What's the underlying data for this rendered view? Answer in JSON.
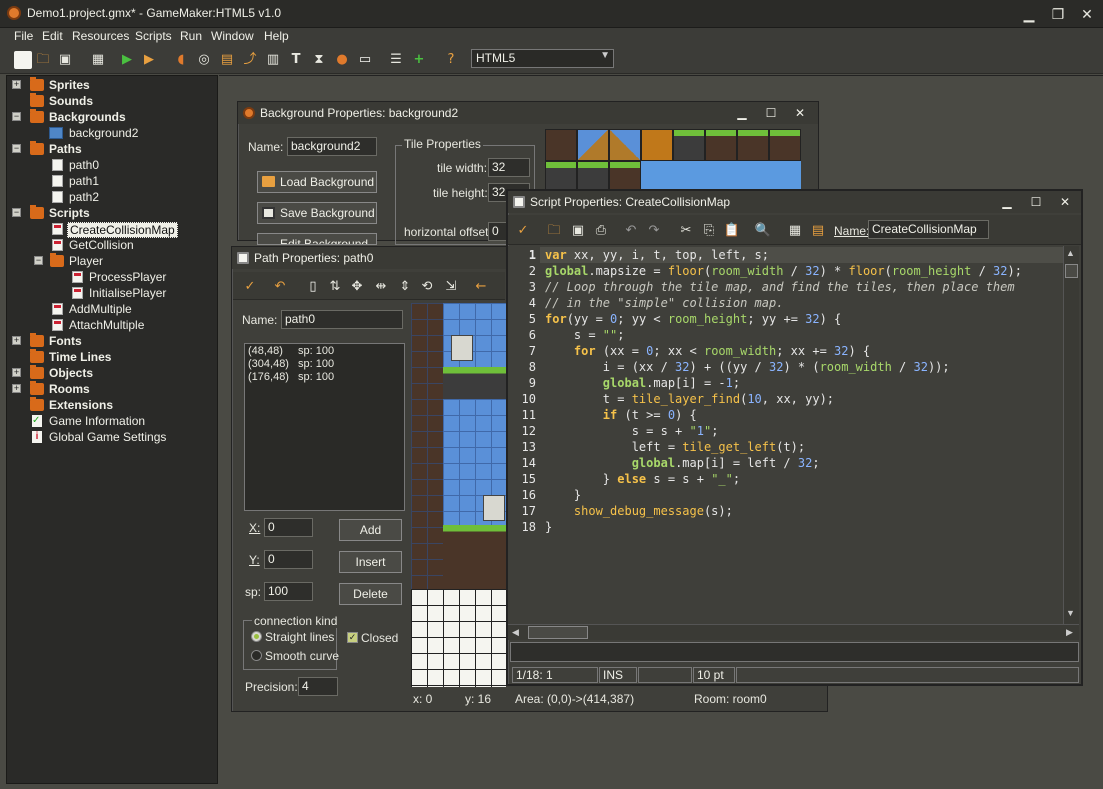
{
  "app": {
    "title": "Demo1.project.gmx* - GameMaker:HTML5 v1.0"
  },
  "menu": [
    "File",
    "Edit",
    "Resources",
    "Scripts",
    "Run",
    "Window",
    "Help"
  ],
  "toolbar": {
    "target": "HTML5"
  },
  "tree": {
    "sprites": "Sprites",
    "sounds": "Sounds",
    "backgrounds": "Backgrounds",
    "background2": "background2",
    "paths": "Paths",
    "path0": "path0",
    "path1": "path1",
    "path2": "path2",
    "scripts": "Scripts",
    "createcollisionmap": "CreateCollisionMap",
    "getcollision": "GetCollision",
    "player": "Player",
    "processplayer": "ProcessPlayer",
    "initialiseplayer": "InitialisePlayer",
    "addmultiple": "AddMultiple",
    "attachmultiple": "AttachMultiple",
    "fonts": "Fonts",
    "timelines": "Time Lines",
    "objects": "Objects",
    "rooms": "Rooms",
    "extensions": "Extensions",
    "gameinfo": "Game Information",
    "globalsettings": "Global Game Settings"
  },
  "bg_window": {
    "title": "Background Properties: background2",
    "name_label": "Name:",
    "name_value": "background2",
    "load": "Load Background",
    "save": "Save Background",
    "edit": "Edit Background",
    "tile_props": "Tile Properties",
    "tile_width_label": "tile width:",
    "tile_width": "32",
    "tile_height_label": "tile height:",
    "tile_height": "32",
    "hoffset_label": "horizontal offset:",
    "hoffset": "0"
  },
  "path_window": {
    "title": "Path Properties: path0",
    "name_label": "Name:",
    "name_value": "path0",
    "points": [
      {
        "xy": "(48,48)",
        "sp": "sp: 100"
      },
      {
        "xy": "(304,48)",
        "sp": "sp: 100"
      },
      {
        "xy": "(176,48)",
        "sp": "sp: 100"
      }
    ],
    "x_label": "X:",
    "x_value": "0",
    "y_label": "Y:",
    "y_value": "0",
    "sp_label": "sp:",
    "sp_value": "100",
    "add": "Add",
    "insert": "Insert",
    "delete": "Delete",
    "conn_kind": "connection kind",
    "straight": "Straight lines",
    "smooth": "Smooth curve",
    "closed": "Closed",
    "precision_label": "Precision:",
    "precision_value": "4",
    "status_x": "x: 0",
    "status_y": "y: 16",
    "status_area": "Area: (0,0)->(414,387)",
    "status_room": "Room: room0"
  },
  "script_window": {
    "title": "Script Properties: CreateCollisionMap",
    "name_label": "Name:",
    "name_value": "CreateCollisionMap",
    "status_pos": "1/18:",
    "status_col": "1",
    "status_mode": "INS",
    "status_size": "10 pt"
  },
  "code_lines": [
    "var xx, yy, i, t, top, left, s;",
    "global.mapsize = floor(room_width / 32) * floor(room_height / 32);",
    "// Loop through the tile map, and find the tiles, then place them",
    "// in the \"simple\" collision map.",
    "for(yy = 0; yy < room_height; yy += 32) {",
    "    s = \"\";",
    "    for (xx = 0; xx < room_width; xx += 32) {",
    "        i = (xx / 32) + ((yy / 32) * (room_width / 32));",
    "        global.map[i] = -1;",
    "        t = tile_layer_find(10, xx, yy);",
    "        if (t >= 0) {",
    "            s = s + \"1\";",
    "            left = tile_get_left(t);",
    "            global.map[i] = left / 32;",
    "        } else s = s + \"_\";",
    "    }",
    "    show_debug_message(s);",
    "}"
  ]
}
